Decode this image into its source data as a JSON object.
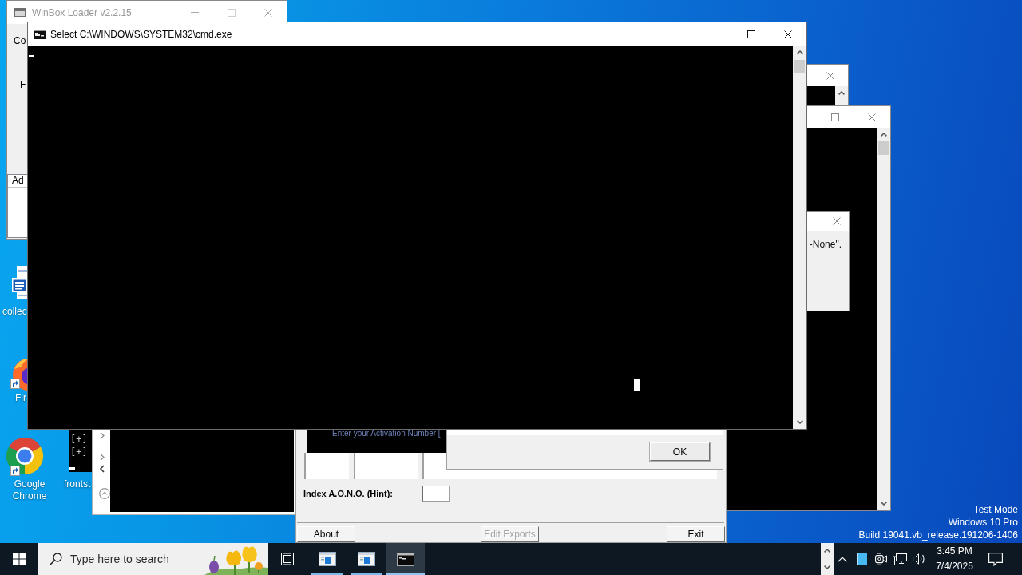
{
  "winbox_window": {
    "title": "WinBox Loader v2.2.15",
    "active": false,
    "labels": [
      "Co",
      "F"
    ],
    "list_header": "Ad"
  },
  "cmd_window": {
    "title": "Select C:\\WINDOWS\\SYSTEM32\\cmd.exe",
    "active": true
  },
  "dialog": {
    "message": "-None\"."
  },
  "desktop_icons": [
    {
      "kind": "document",
      "label": "collec",
      "shortcut": false
    },
    {
      "kind": "browser",
      "label": "Fir",
      "shortcut": true
    },
    {
      "kind": "chrome",
      "label": "Google Chrome",
      "shortcut": true
    }
  ],
  "console_panel": {
    "lines": [
      "[+]",
      "[+]"
    ]
  },
  "desktop_label": "frontst",
  "activation_window": {
    "prompt": "Enter your Activation Number [",
    "hint_label": "Index A.O.N.O. (Hint):",
    "buttons": [
      {
        "label": "About",
        "disabled": false
      },
      {
        "label": "Edit Exports",
        "disabled": true
      },
      {
        "label": "Exit",
        "disabled": false
      }
    ]
  },
  "message_box": {
    "button": "OK"
  },
  "desktop_notice": [
    "Test Mode",
    "Windows 10 Pro",
    "Build 19041.vb_release.191206-1406"
  ],
  "taskbar": {
    "search": {
      "placeholder": "Type here to search"
    },
    "apps": [
      {
        "kind": "window",
        "selected": false
      },
      {
        "kind": "window",
        "selected": false
      },
      {
        "kind": "console",
        "selected": true
      }
    ],
    "clock": {
      "time": "3:45 PM",
      "date": "7/4/2025"
    }
  }
}
